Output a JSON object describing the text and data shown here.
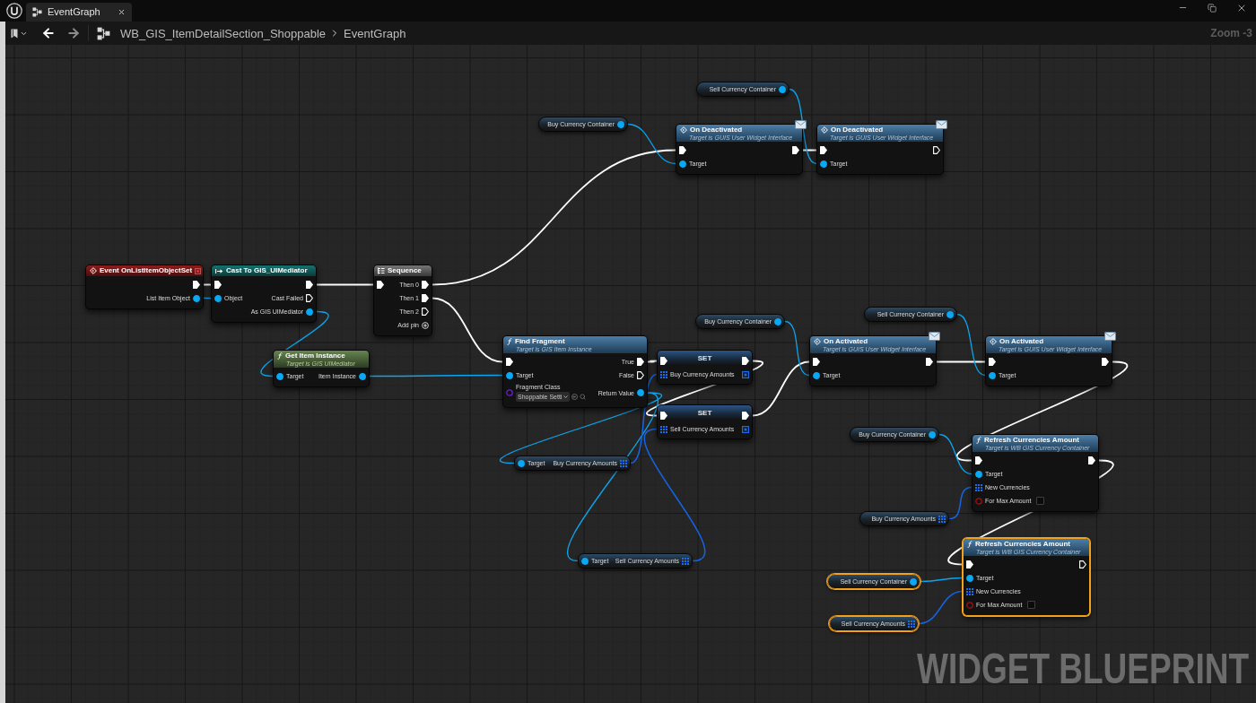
{
  "window": {
    "tab": {
      "label": "EventGraph",
      "selected": true
    }
  },
  "toolbar": {
    "breadcrumb": [
      "WB_GIS_ItemDetailSection_Shoppable",
      "EventGraph"
    ],
    "zoom": "Zoom -3"
  },
  "graph": {
    "nodes": [
      {
        "kind": "getter",
        "selected": false,
        "rows": [
          {
            "right": {
              "kind": "object",
              "label": "Sell Currency Container",
              "connected": true
            }
          }
        ]
      },
      {
        "kind": "getter",
        "selected": false,
        "rows": [
          {
            "right": {
              "kind": "object",
              "label": "Buy Currency Container",
              "connected": true
            }
          }
        ]
      },
      {
        "kind": "message",
        "title": "On Deactivated",
        "subtitle": "Target is GUIS User Widget Interface",
        "selected": false,
        "rows": [
          {
            "left": {
              "kind": "exec",
              "connected": true
            },
            "right": {
              "kind": "exec",
              "connected": true
            }
          },
          {
            "left": {
              "kind": "object",
              "label": "Target",
              "connected": true
            }
          }
        ]
      },
      {
        "kind": "message",
        "title": "On Deactivated",
        "subtitle": "Target is GUIS User Widget Interface",
        "selected": false,
        "rows": [
          {
            "left": {
              "kind": "exec",
              "connected": true
            },
            "right": {
              "kind": "exec",
              "connected": false
            }
          },
          {
            "left": {
              "kind": "object",
              "label": "Target",
              "connected": true
            }
          }
        ]
      },
      {
        "kind": "event",
        "title": "Event OnListItemObjectSet",
        "selected": false,
        "rows": [
          {
            "right": {
              "kind": "exec",
              "connected": true
            }
          },
          {
            "right": {
              "kind": "object",
              "label": "List Item Object",
              "connected": true
            }
          }
        ]
      },
      {
        "kind": "cast",
        "title": "Cast To GIS_UIMediator",
        "selected": false,
        "rows": [
          {
            "left": {
              "kind": "exec",
              "connected": true
            },
            "right": {
              "kind": "exec",
              "connected": true
            }
          },
          {
            "left": {
              "kind": "object",
              "label": "Object",
              "connected": true
            },
            "right": {
              "kind": "exec",
              "label": "Cast Failed",
              "connected": false
            }
          },
          {
            "right": {
              "kind": "object",
              "label": "As GIS UIMediator",
              "connected": true
            }
          }
        ]
      },
      {
        "kind": "sequence",
        "title": "Sequence",
        "selected": false,
        "rows": [
          {
            "left": {
              "kind": "exec",
              "connected": true
            },
            "right": {
              "kind": "exec",
              "label": "Then 0",
              "connected": true
            }
          },
          {
            "right": {
              "kind": "exec",
              "label": "Then 1",
              "connected": true
            }
          },
          {
            "right": {
              "kind": "exec",
              "label": "Then 2",
              "connected": false
            }
          },
          {
            "right": {
              "kind": "add",
              "label": "Add pin"
            }
          }
        ]
      },
      {
        "kind": "getter",
        "selected": false,
        "rows": [
          {
            "right": {
              "kind": "object",
              "label": "Sell Currency Container",
              "connected": true
            }
          }
        ]
      },
      {
        "kind": "getter",
        "selected": false,
        "rows": [
          {
            "right": {
              "kind": "object",
              "label": "Buy Currency Container",
              "connected": true
            }
          }
        ]
      },
      {
        "kind": "pure",
        "title": "Get Item Instance",
        "subtitle": "Target is GIS UIMediator",
        "selected": false,
        "rows": [
          {
            "left": {
              "kind": "object",
              "label": "Target",
              "connected": true
            },
            "right": {
              "kind": "object",
              "label": "Item Instance",
              "connected": true
            }
          }
        ]
      },
      {
        "kind": "function",
        "title": "Find Fragment",
        "subtitle": "Target is GIS Item Instance",
        "selected": false,
        "rows": [
          {
            "left": {
              "kind": "exec",
              "connected": true
            },
            "right": {
              "kind": "exec",
              "label": "True",
              "connected": true
            }
          },
          {
            "left": {
              "kind": "object",
              "label": "Target",
              "connected": true
            },
            "right": {
              "kind": "exec",
              "label": "False",
              "connected": false
            }
          },
          {
            "left": {
              "kind": "class",
              "label": "Fragment Class",
              "connected": false,
              "value": "Shoppable Setti"
            },
            "right": {
              "kind": "object",
              "label": "Return Value",
              "connected": true
            }
          }
        ]
      },
      {
        "kind": "set",
        "title": "SET",
        "selected": false,
        "rows": [
          {
            "left": {
              "kind": "exec",
              "connected": true
            },
            "right": {
              "kind": "exec",
              "connected": true
            }
          },
          {
            "left": {
              "kind": "array",
              "label": "Buy Currency Amounts",
              "connected": true
            },
            "right": {
              "kind": "array",
              "connected": false
            }
          }
        ]
      },
      {
        "kind": "message",
        "title": "On Activated",
        "subtitle": "Target is GUIS User Widget Interface",
        "selected": false,
        "rows": [
          {
            "left": {
              "kind": "exec",
              "connected": true
            },
            "right": {
              "kind": "exec",
              "connected": true
            }
          },
          {
            "left": {
              "kind": "object",
              "label": "Target",
              "connected": true
            }
          }
        ]
      },
      {
        "kind": "message",
        "title": "On Activated",
        "subtitle": "Target is GUIS User Widget Interface",
        "selected": false,
        "rows": [
          {
            "left": {
              "kind": "exec",
              "connected": true
            },
            "right": {
              "kind": "exec",
              "connected": true
            }
          },
          {
            "left": {
              "kind": "object",
              "label": "Target",
              "connected": true
            }
          }
        ]
      },
      {
        "kind": "set",
        "title": "SET",
        "selected": false,
        "rows": [
          {
            "left": {
              "kind": "exec",
              "connected": true
            },
            "right": {
              "kind": "exec",
              "connected": true
            }
          },
          {
            "left": {
              "kind": "array",
              "label": "Sell Currency Amounts",
              "connected": true
            },
            "right": {
              "kind": "array",
              "connected": false
            }
          }
        ]
      },
      {
        "kind": "getter",
        "selected": false,
        "rows": [
          {
            "right": {
              "kind": "object",
              "label": "Buy Currency Container",
              "connected": true
            }
          }
        ]
      },
      {
        "kind": "var_get",
        "selected": false,
        "rows": [
          {
            "left": {
              "kind": "object",
              "label": "Target",
              "connected": true
            },
            "right": {
              "kind": "array",
              "label": "Buy Currency Amounts",
              "connected": true
            }
          }
        ]
      },
      {
        "kind": "function",
        "title": "Refresh Currencies Amount",
        "subtitle": "Target is WB GIS Currency Container",
        "selected": false,
        "rows": [
          {
            "left": {
              "kind": "exec",
              "connected": true
            },
            "right": {
              "kind": "exec",
              "connected": true
            }
          },
          {
            "left": {
              "kind": "object",
              "label": "Target",
              "connected": true
            }
          },
          {
            "left": {
              "kind": "array",
              "label": "New Currencies",
              "connected": true
            }
          },
          {
            "left": {
              "kind": "bool",
              "label": "For Max Amount",
              "connected": false,
              "checked": false
            }
          }
        ]
      },
      {
        "kind": "getter",
        "selected": false,
        "rows": [
          {
            "right": {
              "kind": "array",
              "label": "Buy Currency Amounts",
              "connected": true
            }
          }
        ]
      },
      {
        "kind": "var_get",
        "selected": false,
        "rows": [
          {
            "left": {
              "kind": "object",
              "label": "Target",
              "connected": true
            },
            "right": {
              "kind": "array",
              "label": "Sell Currency Amounts",
              "connected": true
            }
          }
        ]
      },
      {
        "kind": "getter",
        "selected": true,
        "rows": [
          {
            "right": {
              "kind": "object",
              "label": "Sell Currency Container",
              "connected": true
            }
          }
        ]
      },
      {
        "kind": "function",
        "title": "Refresh Currencies Amount",
        "subtitle": "Target is WB GIS Currency Container",
        "selected": true,
        "rows": [
          {
            "left": {
              "kind": "exec",
              "connected": true
            },
            "right": {
              "kind": "exec",
              "connected": false
            }
          },
          {
            "left": {
              "kind": "object",
              "label": "Target",
              "connected": true
            }
          },
          {
            "left": {
              "kind": "array",
              "label": "New Currencies",
              "connected": true
            }
          },
          {
            "left": {
              "kind": "bool",
              "label": "For Max Amount",
              "connected": false,
              "checked": false
            }
          }
        ]
      },
      {
        "kind": "getter",
        "selected": true,
        "rows": [
          {
            "right": {
              "kind": "array",
              "label": "Sell Currency Amounts",
              "connected": true
            }
          }
        ]
      }
    ],
    "graph_type": "WIDGET BLUEPRINT"
  }
}
